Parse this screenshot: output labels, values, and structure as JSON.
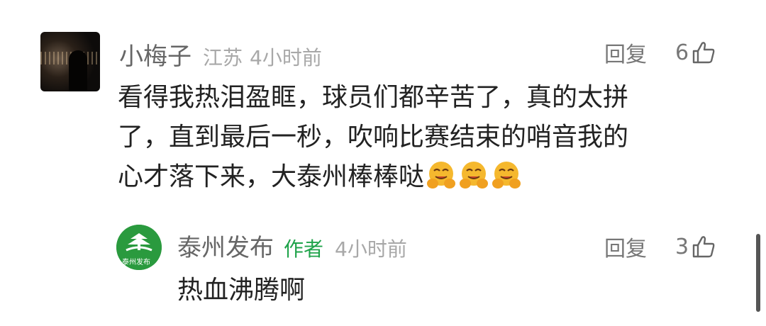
{
  "comment": {
    "username": "小梅子",
    "location": "江苏",
    "time": "4小时前",
    "reply_label": "回复",
    "like_count": "6",
    "text_lines": [
      "看得我热泪盈眶，球员们都辛苦了，真的太拼",
      "了，直到最后一秒，吹响比赛结束的哨音我的",
      "心才落下来，大泰州棒棒哒"
    ],
    "emojis": [
      "hug-face-emoji",
      "hug-face-emoji",
      "hug-face-emoji"
    ]
  },
  "reply": {
    "username": "泰州发布",
    "author_tag": "作者",
    "time": "4小时前",
    "reply_label": "回复",
    "like_count": "3",
    "text": "热血沸腾啊",
    "avatar_text": "泰州发布"
  },
  "colors": {
    "author_tag": "#1fa34a",
    "emoji_yellow": "#f5b82e",
    "avatar_green": "#2a9a3e"
  }
}
